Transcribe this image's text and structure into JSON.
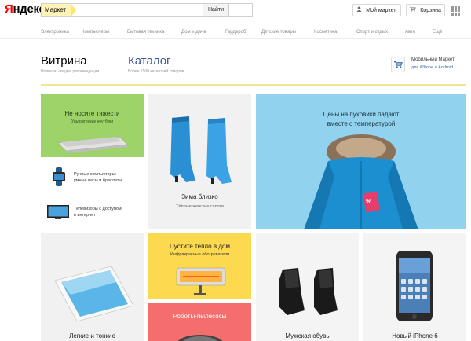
{
  "header": {
    "logo": "Яндекс",
    "search_tag": "Маркет",
    "search_placeholder": "",
    "find_label": "Найти",
    "my_market": "Мой маркет",
    "cart": "Корзина"
  },
  "nav": [
    "Электроника",
    "Компьютеры",
    "Бытовая техника",
    "Дом и дача",
    "Гардероб",
    "Детские товары",
    "Косметика",
    "Спорт и отдых",
    "Авто",
    "Ещё"
  ],
  "page": {
    "vitrina": "Витрина",
    "vitrina_sub": "Новинки, скидки, рекомендации",
    "catalog": "Каталог",
    "catalog_sub": "Более 1500 категорий товаров",
    "mobile_title": "Мобильный Маркет",
    "mobile_link": "для iPhone и Android"
  },
  "tiles": {
    "laptops_title": "Не носите тяжести",
    "laptops_sub": "Ультратонкие ноутбуки",
    "watches": [
      "Ручные компьютеры:",
      "умные часы и браслеты"
    ],
    "tv": [
      "Телевизоры с доступом",
      "в интернет"
    ],
    "boots_title": "Зима близко",
    "boots_sub": "Тёплые женские сапоги",
    "jackets": [
      "Цены на пуховики падают",
      "вместе с температурой"
    ],
    "jacket_tag": "%",
    "ipad_title": "Легкие и тонкие",
    "heater_title": "Пустите тепло в дом",
    "heater_sub": "Инфракрасные обогреватели",
    "robots_title": "Роботы-пылесосы",
    "shoes_title": "Мужская обувь",
    "iphone_title": "Новый iPhone 6"
  },
  "colors": {
    "green": "#9ed36a",
    "blue": "#91d3ef",
    "yellow": "#fcd94e",
    "red": "#f56e6e",
    "link": "#3c5a98"
  }
}
